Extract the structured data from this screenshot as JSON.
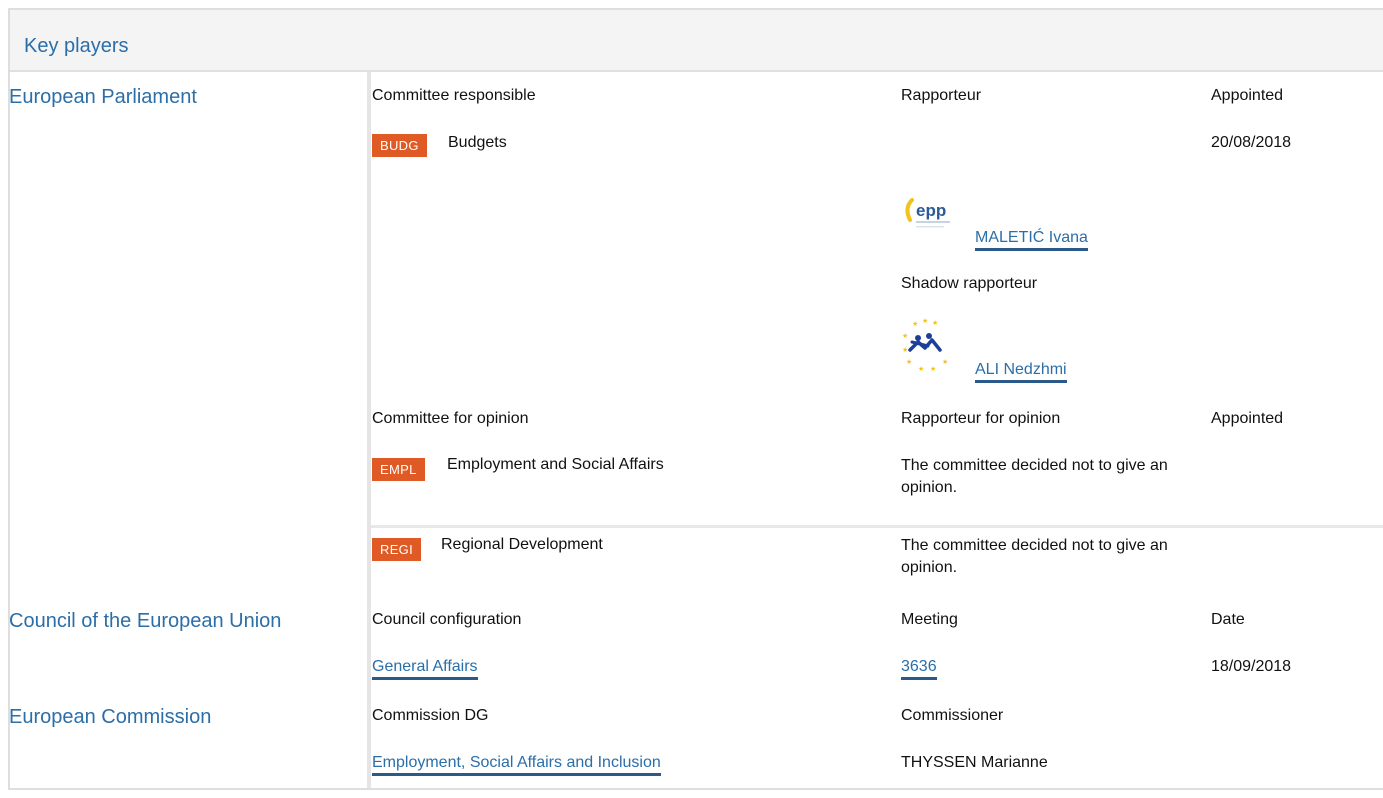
{
  "header": {
    "title": "Key players"
  },
  "parliament": {
    "name": "European Parliament",
    "responsible": {
      "col_committee": "Committee responsible",
      "col_rapporteur": "Rapporteur",
      "col_appointed": "Appointed",
      "badge": "BUDG",
      "committee": "Budgets",
      "appointed": "20/08/2018",
      "rapporteur": "MALETIĆ Ivana",
      "rapporteur_group_icon": "epp-logo",
      "shadow_label": "Shadow rapporteur",
      "shadow": "ALI Nedzhmi",
      "shadow_group_icon": "renew-logo"
    },
    "opinion": {
      "col_committee": "Committee for opinion",
      "col_rapporteur": "Rapporteur for opinion",
      "col_appointed": "Appointed",
      "rows": [
        {
          "badge": "EMPL",
          "committee": "Employment and Social Affairs",
          "note": "The committee decided not to give an opinion."
        },
        {
          "badge": "REGI",
          "committee": "Regional Development",
          "note": "The committee decided not to give an opinion."
        }
      ]
    }
  },
  "council": {
    "name": "Council of the European Union",
    "col_config": "Council configuration",
    "col_meeting": "Meeting",
    "col_date": "Date",
    "config": "General Affairs",
    "meeting": "3636",
    "date": "18/09/2018"
  },
  "commission": {
    "name": "European Commission",
    "col_dg": "Commission DG",
    "col_commissioner": "Commissioner",
    "dg": "Employment, Social Affairs and Inclusion",
    "commissioner": "THYSSEN Marianne"
  },
  "colors": {
    "link": "#2b6ea8",
    "badge": "#e05a25",
    "header_bg": "#f4f4f4"
  }
}
